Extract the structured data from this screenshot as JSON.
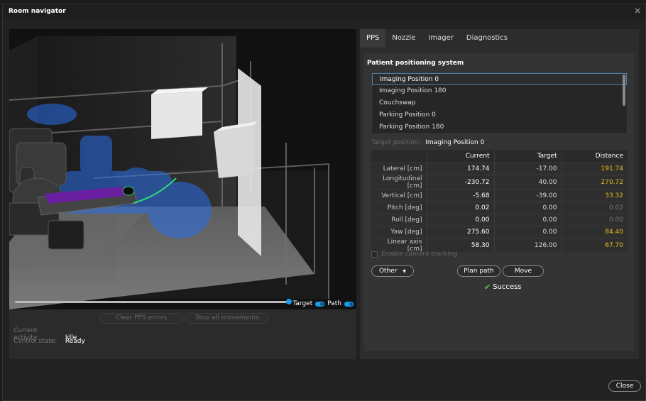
{
  "window": {
    "title": "Room navigator",
    "close_glyph": "×"
  },
  "viewport": {
    "legend": {
      "target_label": "Target",
      "path_label": "Path"
    }
  },
  "status": {
    "clear_errors_label": "Clear PPS errors",
    "stop_movements_label": "Stop all movements",
    "current_activity_label": "Current activity:",
    "current_activity_value": "Idle",
    "control_state_label": "Control state:",
    "control_state_value": "Ready"
  },
  "tabs": [
    {
      "label": "PPS",
      "active": true
    },
    {
      "label": "Nozzle",
      "active": false
    },
    {
      "label": "Imager",
      "active": false
    },
    {
      "label": "Diagnostics",
      "active": false
    }
  ],
  "pps": {
    "section_title": "Patient positioning system",
    "positions": [
      "Imaging Position 0",
      "Imaging Position 180",
      "Couchswap",
      "Parking Position 0",
      "Parking Position 180"
    ],
    "selected_index": 0,
    "target_position_label": "Target position:",
    "target_position_value": "Imaging Position 0",
    "table": {
      "headers": [
        "",
        "Current",
        "Target",
        "Distance"
      ],
      "rows": [
        {
          "label": "Lateral [cm]",
          "current": "174.74",
          "target": "-17.00",
          "distance": "191.74",
          "zero": false
        },
        {
          "label": "Longitudinal [cm]",
          "current": "-230.72",
          "target": "40.00",
          "distance": "270.72",
          "zero": false
        },
        {
          "label": "Vertical [cm]",
          "current": "-5.68",
          "target": "-39.00",
          "distance": "33.32",
          "zero": false
        },
        {
          "label": "Pitch [deg]",
          "current": "0.02",
          "target": "0.00",
          "distance": "0.02",
          "zero": true
        },
        {
          "label": "Roll [deg]",
          "current": "0.00",
          "target": "0.00",
          "distance": "0.00",
          "zero": true
        },
        {
          "label": "Yaw [deg]",
          "current": "275.60",
          "target": "0.00",
          "distance": "84.40",
          "zero": false
        },
        {
          "label": "Linear axis [cm]",
          "current": "58.30",
          "target": "126.00",
          "distance": "67.70",
          "zero": false
        }
      ]
    },
    "camera_tracking_label": "Enable camera tracking",
    "other_label": "Other",
    "plan_path_label": "Plan path",
    "move_label": "Move",
    "success_label": "Success"
  },
  "footer": {
    "close_label": "Close"
  },
  "colors": {
    "accent": "#1b9be8",
    "distance_highlight": "#e8c020",
    "success": "#5cc84a"
  }
}
